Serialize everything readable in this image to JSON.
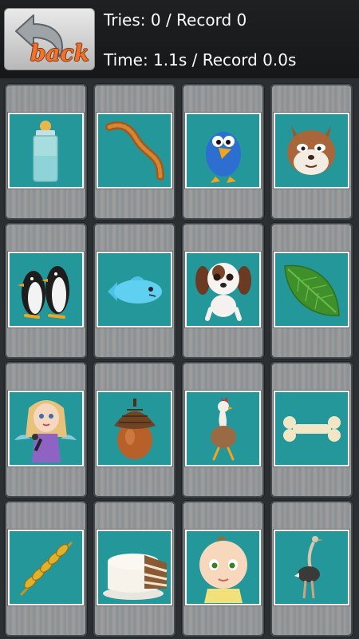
{
  "header": {
    "back_label": "back",
    "tries_text": "Tries: 0 / Record 0",
    "time_text": "Time: 1.1s / Record 0.0s"
  },
  "colors": {
    "card_background": "#24979a",
    "card_border": "#ffffff",
    "back_label": "#f0722c",
    "text": "#ffffff"
  },
  "cards": [
    {
      "icon": "baby-bottle-icon"
    },
    {
      "icon": "worm-icon"
    },
    {
      "icon": "blue-bird-icon"
    },
    {
      "icon": "chipmunk-icon"
    },
    {
      "icon": "penguins-icon"
    },
    {
      "icon": "fish-icon"
    },
    {
      "icon": "puppy-icon"
    },
    {
      "icon": "leaf-icon"
    },
    {
      "icon": "fairy-singer-icon"
    },
    {
      "icon": "acorn-icon"
    },
    {
      "icon": "chicken-icon"
    },
    {
      "icon": "bone-icon"
    },
    {
      "icon": "wheat-icon"
    },
    {
      "icon": "cake-icon"
    },
    {
      "icon": "baby-icon"
    },
    {
      "icon": "ostrich-icon"
    }
  ]
}
